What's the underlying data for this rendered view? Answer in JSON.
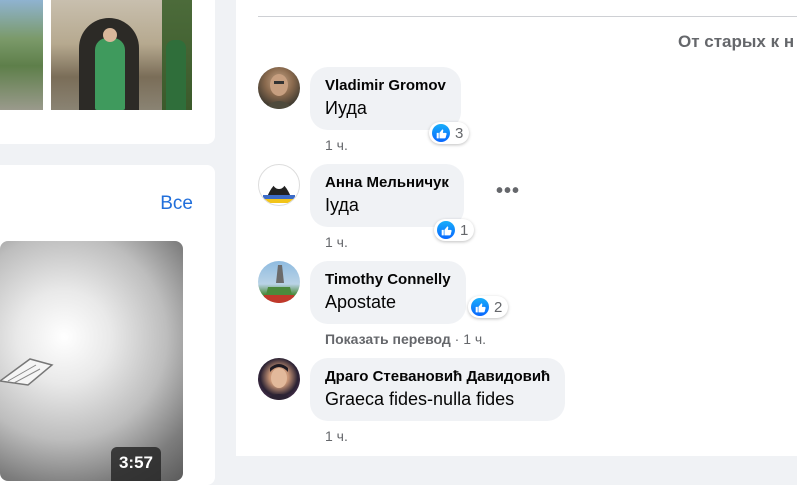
{
  "left": {
    "video_section": {
      "all_link": "Все",
      "duration": "3:57"
    }
  },
  "comments": {
    "sort_label": "От старых к н",
    "items": [
      {
        "author": "Vladimir Gromov",
        "text": "Иуда",
        "likes": "3",
        "time": "1 ч."
      },
      {
        "author": "Анна Мельничук",
        "text": "Іуда",
        "likes": "1",
        "time": "1 ч.",
        "more": "•••"
      },
      {
        "author": "Timothy Connelly",
        "text": "Apostate",
        "likes": "2",
        "translate": "Показать перевод",
        "sep": " · ",
        "time": "1 ч."
      },
      {
        "author": "Драго Стевановић Давидовић",
        "text": "Graeca fides-nulla fides",
        "time": "1 ч."
      }
    ]
  },
  "colors": {
    "link": "#216fdb",
    "like_blue": "#0866ff",
    "bubble": "#f0f2f5",
    "meta": "#65676b"
  },
  "icons": [
    "like-icon",
    "more-options-icon"
  ]
}
